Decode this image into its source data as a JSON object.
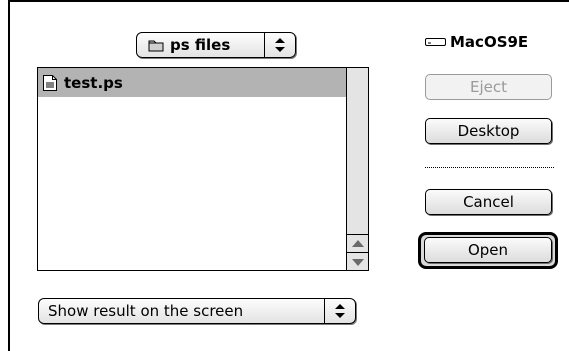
{
  "folder_popup": {
    "label": "ps files",
    "icon": "folder-icon"
  },
  "file_list": {
    "items": [
      {
        "name": "test.ps",
        "icon": "document-icon",
        "selected": true
      }
    ]
  },
  "disk": {
    "name": "MacOS9E",
    "icon": "disk-icon"
  },
  "buttons": {
    "eject": "Eject",
    "desktop": "Desktop",
    "cancel": "Cancel",
    "open": "Open"
  },
  "result_popup": {
    "label": "Show result on the screen"
  },
  "colors": {
    "selection": "#b3b3b3",
    "disabled_text": "#9a9a9a",
    "scrollbar": "#e4e4e4"
  }
}
